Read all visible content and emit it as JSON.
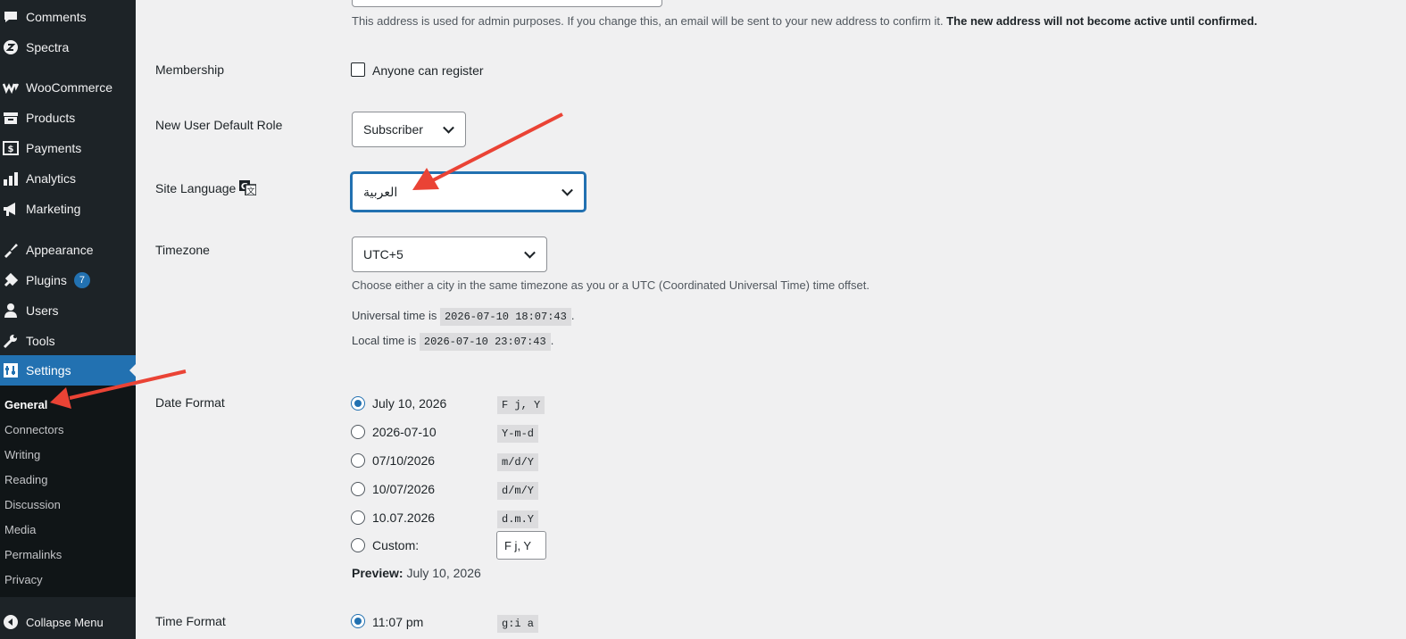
{
  "sidebar": {
    "items": [
      {
        "label": "Comments",
        "icon": "comments-icon"
      },
      {
        "label": "Spectra",
        "icon": "spectra-icon"
      },
      {
        "label": "WooCommerce",
        "icon": "woocommerce-icon"
      },
      {
        "label": "Products",
        "icon": "products-icon"
      },
      {
        "label": "Payments",
        "icon": "payments-icon"
      },
      {
        "label": "Analytics",
        "icon": "analytics-icon"
      },
      {
        "label": "Marketing",
        "icon": "marketing-icon"
      },
      {
        "label": "Appearance",
        "icon": "appearance-icon"
      },
      {
        "label": "Plugins",
        "icon": "plugins-icon",
        "badge": "7"
      },
      {
        "label": "Users",
        "icon": "users-icon"
      },
      {
        "label": "Tools",
        "icon": "tools-icon"
      },
      {
        "label": "Settings",
        "icon": "settings-icon",
        "active": true
      }
    ],
    "submenu": [
      "General",
      "Connectors",
      "Writing",
      "Reading",
      "Discussion",
      "Media",
      "Permalinks",
      "Privacy"
    ],
    "collapse_label": "Collapse Menu"
  },
  "email": {
    "description": "This address is used for admin purposes. If you change this, an email will be sent to your new address to confirm it.",
    "description_bold": "The new address will not become active until confirmed."
  },
  "membership": {
    "label": "Membership",
    "checkbox_label": "Anyone can register",
    "checked": false
  },
  "default_role": {
    "label": "New User Default Role",
    "value": "Subscriber"
  },
  "site_language": {
    "label": "Site Language",
    "value": "العربية",
    "icon": "translation-icon"
  },
  "timezone": {
    "label": "Timezone",
    "value": "UTC+5",
    "description": "Choose either a city in the same timezone as you or a UTC (Coordinated Universal Time) time offset.",
    "universal_prefix": "Universal time is",
    "universal_time": "2026-07-10 18:07:43",
    "local_prefix": "Local time is",
    "local_time": "2026-07-10 23:07:43",
    "period": "."
  },
  "date_format": {
    "label": "Date Format",
    "options": [
      {
        "label": "July 10, 2026",
        "code": "F j, Y",
        "checked": true
      },
      {
        "label": "2026-07-10",
        "code": "Y-m-d"
      },
      {
        "label": "07/10/2026",
        "code": "m/d/Y"
      },
      {
        "label": "10/07/2026",
        "code": "d/m/Y"
      },
      {
        "label": "10.07.2026",
        "code": "d.m.Y"
      },
      {
        "label": "Custom:",
        "custom_value": "F j, Y"
      }
    ],
    "preview_label": "Preview:",
    "preview_value": "July 10, 2026"
  },
  "time_format": {
    "label": "Time Format",
    "options": [
      {
        "label": "11:07 pm",
        "code": "g:i a",
        "checked": true
      }
    ]
  },
  "colors": {
    "admin_bar": "#1d2327",
    "accent": "#2271b1",
    "annotation_arrow": "#ea4335",
    "background": "#f0f0f1"
  }
}
